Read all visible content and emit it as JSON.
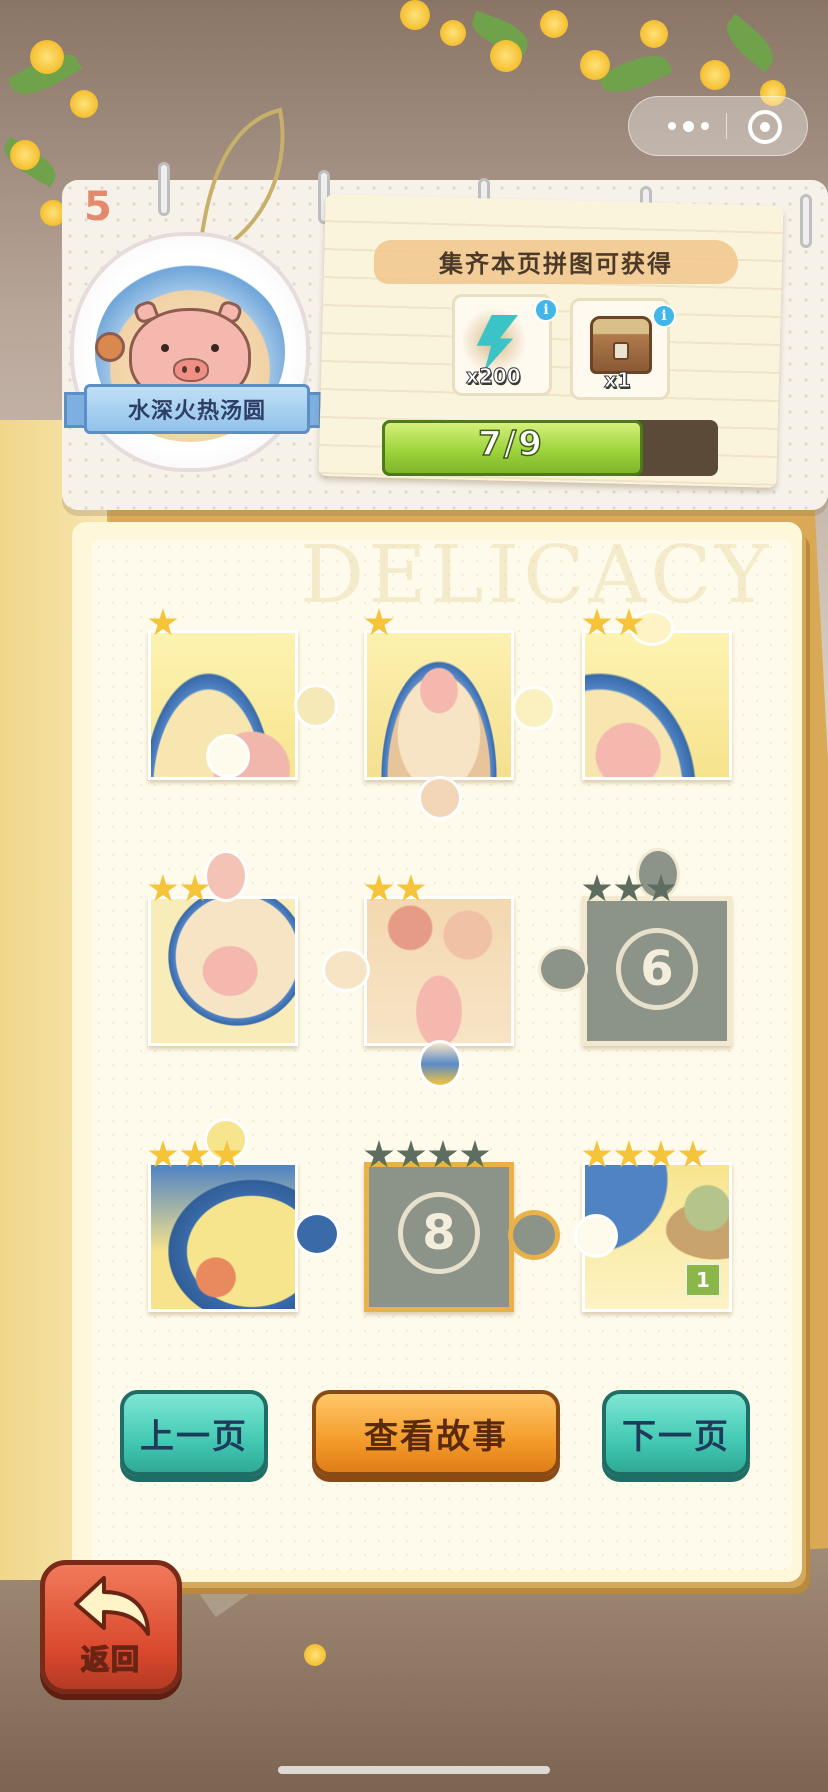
{
  "chapter": {
    "number": "5",
    "badge_title": "水深火热汤圆"
  },
  "reward": {
    "title": "集齐本页拼图可获得",
    "items": [
      {
        "icon": "energy-bolt-icon",
        "quantity": "x200"
      },
      {
        "icon": "treasure-chest-icon",
        "quantity": "x1"
      }
    ],
    "info_glyph": "i"
  },
  "progress": {
    "label": "7/9",
    "collected": 7,
    "total": 9
  },
  "watermark": "DELICACY",
  "pieces": [
    {
      "id": 1,
      "state": "unlocked",
      "stars": 1
    },
    {
      "id": 2,
      "state": "unlocked",
      "stars": 1
    },
    {
      "id": 3,
      "state": "unlocked",
      "stars": 2
    },
    {
      "id": 4,
      "state": "unlocked",
      "stars": 2
    },
    {
      "id": 5,
      "state": "unlocked",
      "stars": 2
    },
    {
      "id": 6,
      "state": "locked",
      "stars": 3,
      "label": "6"
    },
    {
      "id": 7,
      "state": "unlocked",
      "stars": 3
    },
    {
      "id": 8,
      "state": "locked",
      "stars": 4,
      "label": "8"
    },
    {
      "id": 9,
      "state": "unlocked",
      "stars": 4,
      "duplicate_count": "1"
    }
  ],
  "buttons": {
    "prev": "上一页",
    "story": "查看故事",
    "next": "下一页",
    "back": "返回"
  },
  "colors": {
    "accent_teal": "#43c9b4",
    "accent_orange": "#f49b2b",
    "progress_green": "#9ed43c",
    "star_gold": "#f6c43a"
  }
}
